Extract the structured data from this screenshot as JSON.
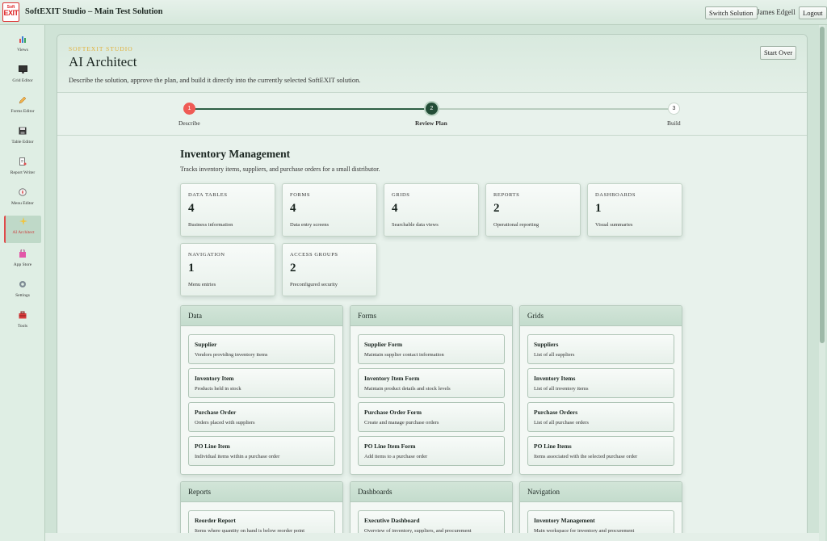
{
  "topbar": {
    "logo_small": "Soft",
    "logo_big": "EXIT",
    "title": "SoftEXIT Studio – Main Test Solution",
    "switch_label": "Switch Solution",
    "user": "James Edgell",
    "logout_label": "Logout"
  },
  "sidebar": {
    "items": [
      {
        "label": "Views",
        "icon": "bar-chart-icon"
      },
      {
        "label": "Grid Editor",
        "icon": "monitor-icon"
      },
      {
        "label": "Forms Editor",
        "icon": "pencil-icon"
      },
      {
        "label": "Table Editor",
        "icon": "floppy-icon"
      },
      {
        "label": "Report Writer",
        "icon": "report-icon"
      },
      {
        "label": "Menu Editor",
        "icon": "compass-icon"
      },
      {
        "label": "AI Architect",
        "icon": "sparkle-icon",
        "active": true
      },
      {
        "label": "App Store",
        "icon": "shopping-bag-icon"
      },
      {
        "label": "Settings",
        "icon": "gear-icon"
      },
      {
        "label": "Tools",
        "icon": "toolbox-icon"
      }
    ]
  },
  "header": {
    "eyebrow": "SOFTEXIT STUDIO",
    "title": "AI Architect",
    "description": "Describe the solution, approve the plan, and build it directly into the currently selected SoftEXIT solution.",
    "start_over": "Start Over"
  },
  "stepper": {
    "steps": [
      {
        "num": "1",
        "label": "Describe"
      },
      {
        "num": "2",
        "label": "Review Plan"
      },
      {
        "num": "3",
        "label": "Build"
      }
    ],
    "current": 2
  },
  "solution": {
    "title": "Inventory Management",
    "description": "Tracks inventory items, suppliers, and purchase orders for a small distributor."
  },
  "stats": [
    {
      "key": "DATA TABLES",
      "value": "4",
      "desc": "Business information"
    },
    {
      "key": "FORMS",
      "value": "4",
      "desc": "Data entry screens"
    },
    {
      "key": "GRIDS",
      "value": "4",
      "desc": "Searchable data views"
    },
    {
      "key": "REPORTS",
      "value": "2",
      "desc": "Operational reporting"
    },
    {
      "key": "DASHBOARDS",
      "value": "1",
      "desc": "Visual summaries"
    },
    {
      "key": "NAVIGATION",
      "value": "1",
      "desc": "Menu entries"
    },
    {
      "key": "ACCESS GROUPS",
      "value": "2",
      "desc": "Preconfigured security"
    }
  ],
  "cards": [
    {
      "title": "Data",
      "items": [
        {
          "name": "Supplier",
          "desc": "Vendors providing inventory items"
        },
        {
          "name": "Inventory Item",
          "desc": "Products held in stock"
        },
        {
          "name": "Purchase Order",
          "desc": "Orders placed with suppliers"
        },
        {
          "name": "PO Line Item",
          "desc": "Individual items within a purchase order"
        }
      ]
    },
    {
      "title": "Forms",
      "items": [
        {
          "name": "Supplier Form",
          "desc": "Maintain supplier contact information"
        },
        {
          "name": "Inventory Item Form",
          "desc": "Maintain product details and stock levels"
        },
        {
          "name": "Purchase Order Form",
          "desc": "Create and manage purchase orders"
        },
        {
          "name": "PO Line Item Form",
          "desc": "Add items to a purchase order"
        }
      ]
    },
    {
      "title": "Grids",
      "items": [
        {
          "name": "Suppliers",
          "desc": "List of all suppliers"
        },
        {
          "name": "Inventory Items",
          "desc": "List of all inventory items"
        },
        {
          "name": "Purchase Orders",
          "desc": "List of all purchase orders"
        },
        {
          "name": "PO Line Items",
          "desc": "Items associated with the selected purchase order"
        }
      ]
    },
    {
      "title": "Reports",
      "items": [
        {
          "name": "Reorder Report",
          "desc": "Items where quantity on hand is below reorder point"
        }
      ]
    },
    {
      "title": "Dashboards",
      "items": [
        {
          "name": "Executive Dashboard",
          "desc": "Overview of inventory, suppliers, and procurement"
        }
      ]
    },
    {
      "title": "Navigation",
      "items": [
        {
          "name": "Inventory Management",
          "desc": "Main workspace for inventory and procurement"
        }
      ]
    }
  ],
  "colors": {
    "accent_red": "#ef5b55",
    "step_active": "#234d37",
    "eyebrow": "#e0b03a"
  }
}
